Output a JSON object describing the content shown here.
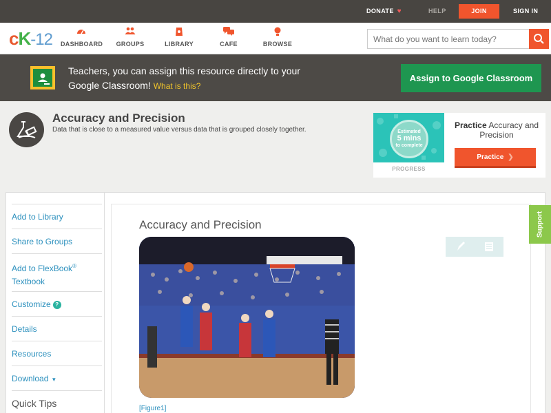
{
  "topbar": {
    "donate": "DONATE",
    "help": "HELP",
    "join": "JOIN",
    "signin": "SIGN IN"
  },
  "nav": {
    "logo": {
      "c": "c",
      "k": "K",
      "n": "-12"
    },
    "items": [
      {
        "label": "DASHBOARD",
        "icon": "dashboard-icon"
      },
      {
        "label": "GROUPS",
        "icon": "groups-icon"
      },
      {
        "label": "LIBRARY",
        "icon": "library-icon"
      },
      {
        "label": "CAFE",
        "icon": "cafe-icon"
      },
      {
        "label": "BROWSE",
        "icon": "browse-icon"
      }
    ],
    "search_placeholder": "What do you want to learn today?"
  },
  "banner": {
    "text": "Teachers, you can assign this resource directly to your Google Classroom!",
    "what_link": "What is this?",
    "assign_button": "Assign to Google Classroom"
  },
  "concept": {
    "title": "Accuracy and Precision",
    "description": "Data that is close to a measured value versus data that is grouped closely together."
  },
  "practice": {
    "estimated_line1": "Estimated",
    "estimated_mins": "5 mins",
    "estimated_line3": "to complete",
    "progress_label": "PROGRESS",
    "title_bold": "Practice",
    "title_rest": "Accuracy and Precision",
    "button": "Practice"
  },
  "sidebar": {
    "items": [
      {
        "label": "Add to Library"
      },
      {
        "label": "Share to Groups"
      },
      {
        "label": "Add to FlexBook",
        "sup": "®",
        "line2": "Textbook"
      },
      {
        "label": "Customize",
        "badge": "?"
      },
      {
        "label": "Details"
      },
      {
        "label": "Resources"
      },
      {
        "label": "Download",
        "caret": "▼"
      }
    ],
    "quick_tips": "Quick Tips"
  },
  "article": {
    "title": "Accuracy and Precision",
    "caption": "[Figure1]"
  },
  "support": "Support",
  "colors": {
    "accent": "#f0552d",
    "link": "#2a8fbd",
    "google_green": "#1e9650",
    "dark": "#484541"
  }
}
